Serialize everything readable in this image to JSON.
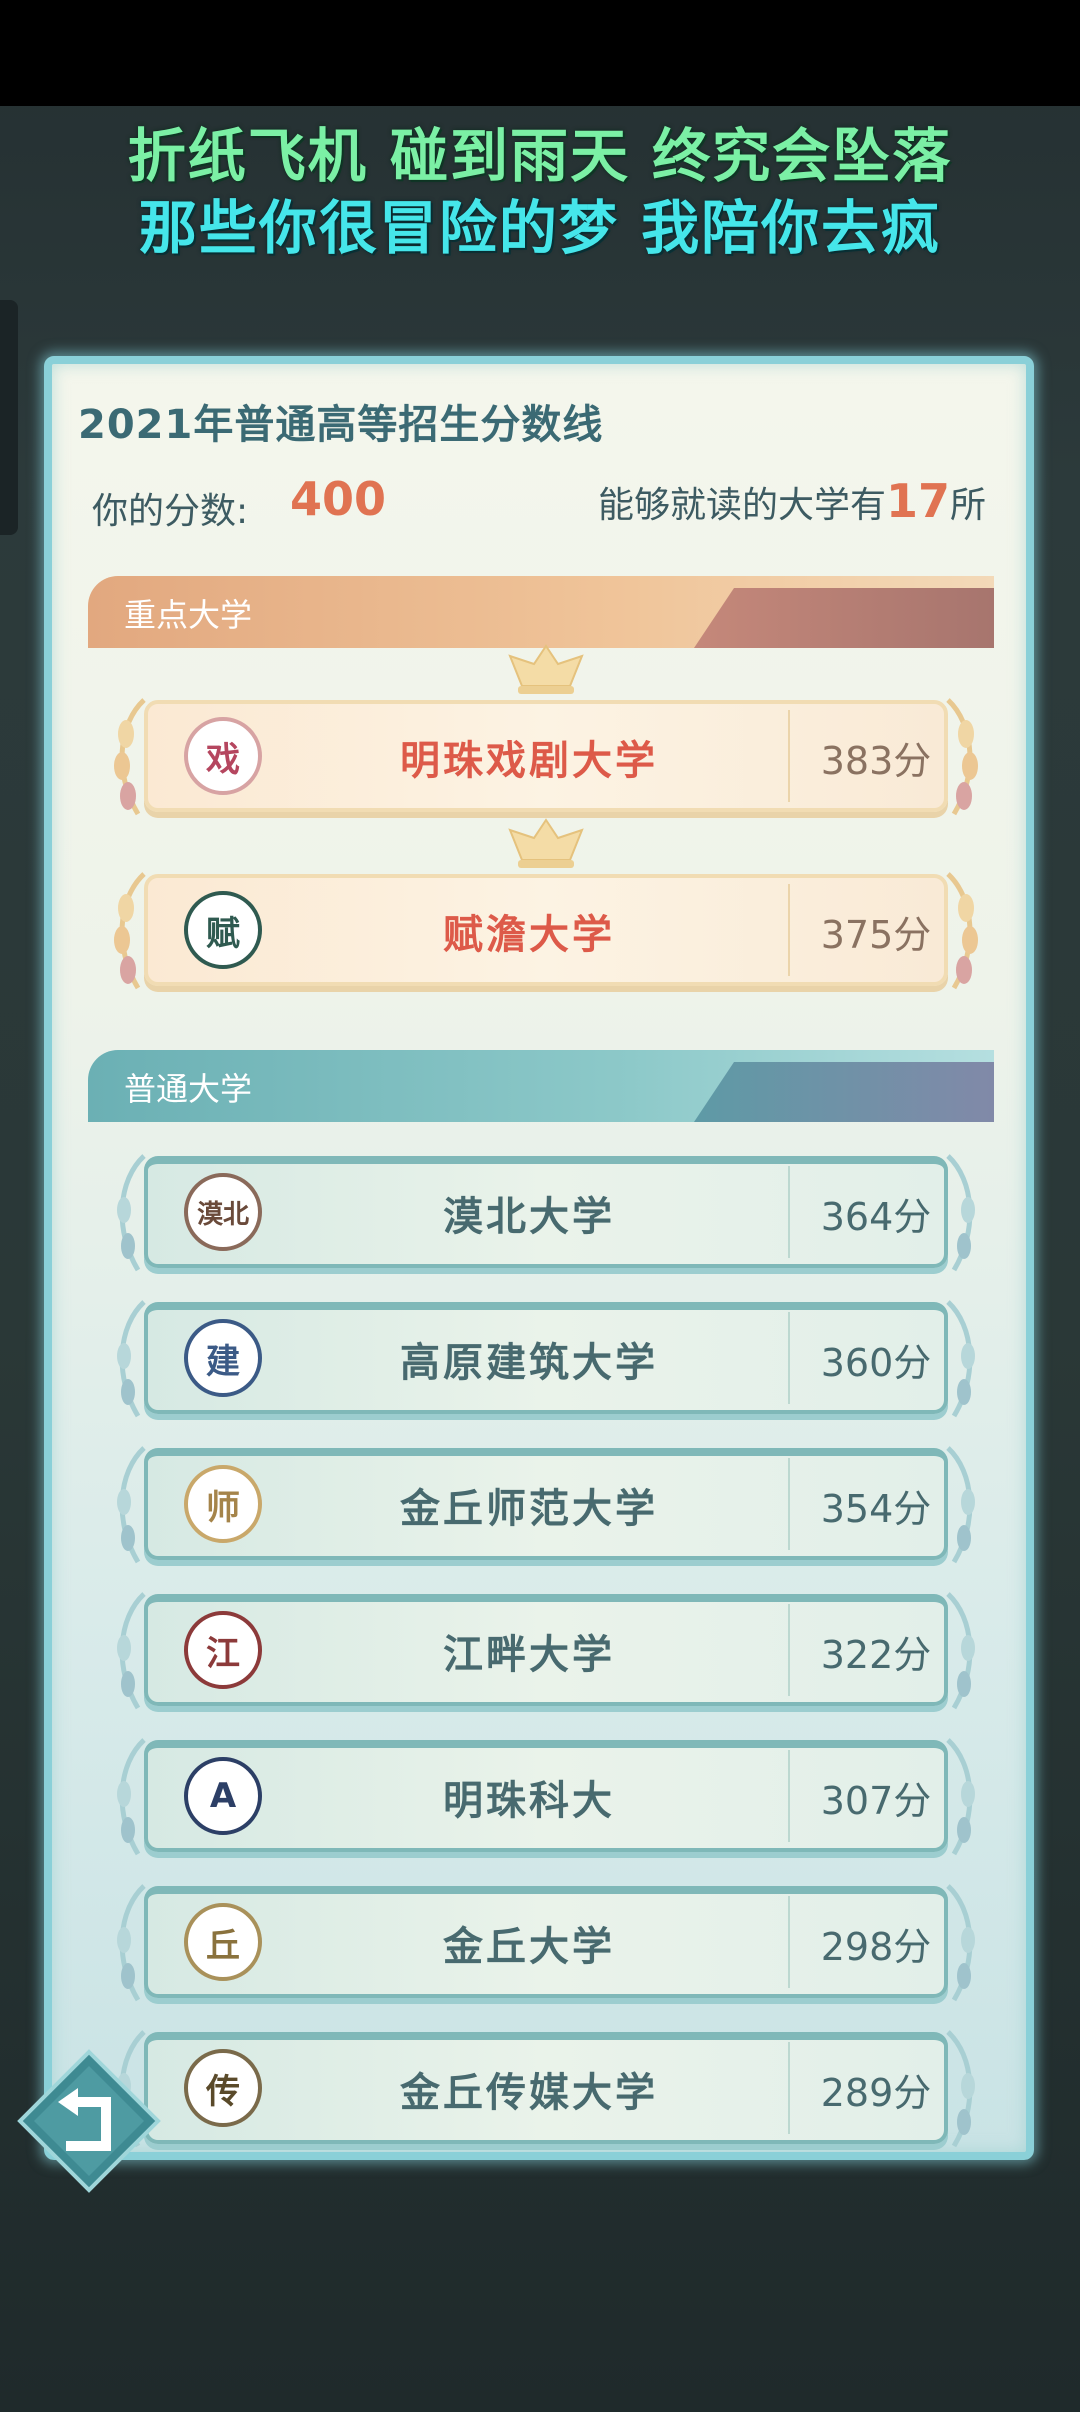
{
  "lyrics": {
    "line1": "折纸飞机 碰到雨天 终究会坠落",
    "line2": "那些你很冒险的梦 我陪你去疯"
  },
  "panel": {
    "title": "2021年普通高等招生分数线",
    "score_label": "你的分数:",
    "score_value": "400",
    "count_prefix": "能够就读的大学有",
    "count_value": "17",
    "count_suffix": "所"
  },
  "sections": {
    "key_title": "重点大学",
    "normal_title": "普通大学"
  },
  "key_universities": [
    {
      "name": "明珠戏剧大学",
      "score": "383分",
      "logo_icon": "drama-university-seal-icon",
      "logo_glyph": "戏"
    },
    {
      "name": "赋澹大学",
      "score": "375分",
      "logo_icon": "fudan-seal-icon",
      "logo_glyph": "赋"
    }
  ],
  "normal_universities": [
    {
      "name": "漠北大学",
      "score": "364分",
      "logo_icon": "mobei-seal-icon",
      "logo_glyph": "漠北"
    },
    {
      "name": "高原建筑大学",
      "score": "360分",
      "logo_icon": "architecture-seal-icon",
      "logo_glyph": "建"
    },
    {
      "name": "金丘师范大学",
      "score": "354分",
      "logo_icon": "normal-university-seal-icon",
      "logo_glyph": "师"
    },
    {
      "name": "江畔大学",
      "score": "322分",
      "logo_icon": "jiangpan-seal-icon",
      "logo_glyph": "江"
    },
    {
      "name": "明珠科大",
      "score": "307分",
      "logo_icon": "science-tech-seal-icon",
      "logo_glyph": "A"
    },
    {
      "name": "金丘大学",
      "score": "298分",
      "logo_icon": "jinqiu-seal-icon",
      "logo_glyph": "丘"
    },
    {
      "name": "金丘传媒大学",
      "score": "289分",
      "logo_icon": "media-university-seal-icon",
      "logo_glyph": "传"
    }
  ],
  "colors": {
    "accent_score": "#e07352",
    "key_name": "#dd5a49",
    "normal_name": "#486a6f"
  },
  "back_button": {
    "icon": "back-arrow-icon"
  }
}
